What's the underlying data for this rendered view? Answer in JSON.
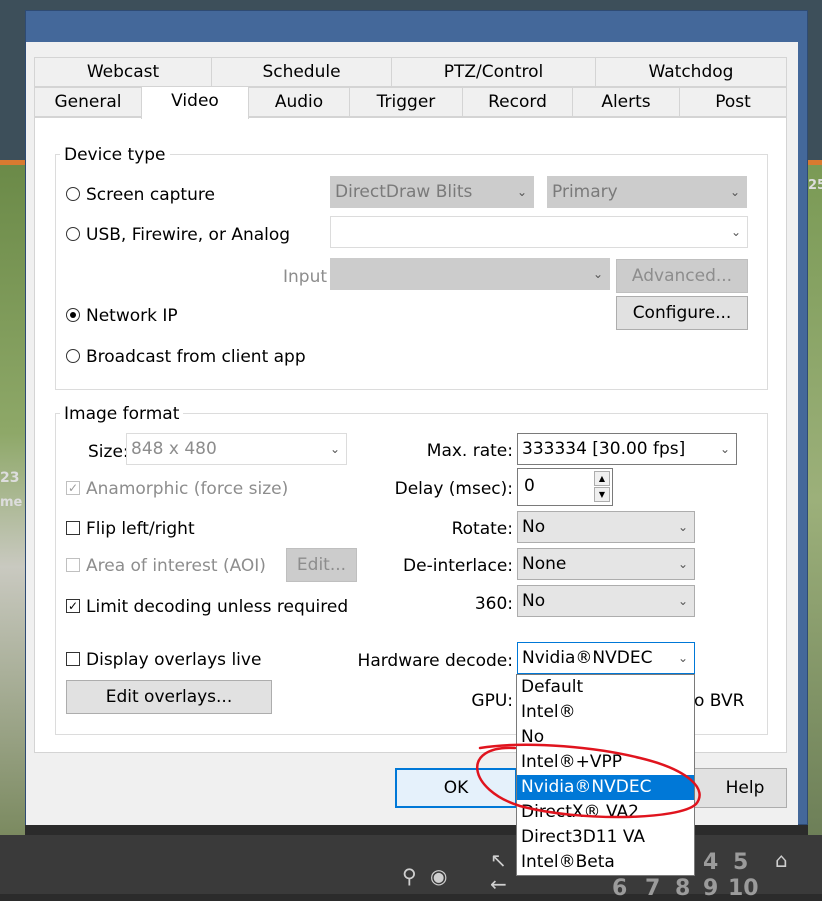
{
  "background": {
    "numbers": [
      "23",
      "25",
      "me",
      "4",
      "5",
      "6",
      "7",
      "8",
      "9",
      "10"
    ]
  },
  "tabs": {
    "row1": [
      "Webcast",
      "Schedule",
      "PTZ/Control",
      "Watchdog"
    ],
    "row2": [
      "General",
      "Video",
      "Audio",
      "Trigger",
      "Record",
      "Alerts",
      "Post"
    ],
    "active": "Video"
  },
  "device_type": {
    "title": "Device type",
    "screen_capture": "Screen capture",
    "screen_combo1": "DirectDraw Blits",
    "screen_combo2": "Primary",
    "usb": "USB, Firewire, or Analog",
    "usb_combo": "",
    "input_label": "Input",
    "input_combo": "",
    "advanced": "Advanced...",
    "network_ip": "Network IP",
    "configure": "Configure...",
    "broadcast": "Broadcast from client app"
  },
  "image_format": {
    "title": "Image format",
    "size_label": "Size:",
    "size_value": "848 x 480",
    "anamorphic": "Anamorphic (force size)",
    "flip": "Flip left/right",
    "aoi": "Area of interest (AOI)",
    "edit": "Edit...",
    "limit_decoding": "Limit decoding unless required",
    "display_overlays": "Display overlays live",
    "edit_overlays": "Edit overlays...",
    "max_rate_label": "Max. rate:",
    "max_rate_value": "333334 [30.00 fps]",
    "delay_label": "Delay (msec):",
    "delay_value": "0",
    "rotate_label": "Rotate:",
    "rotate_value": "No",
    "deinterlace_label": "De-interlace:",
    "deinterlace_value": "None",
    "r360_label": "360:",
    "r360_value": "No",
    "hw_label": "Hardware decode:",
    "hw_value": "Nvidia®NVDEC",
    "gpu_label": "GPU:",
    "gpu_trail": "o BVR"
  },
  "dropdown": {
    "options": [
      "Default",
      "Intel®",
      "No",
      "Intel®+VPP",
      "Nvidia®NVDEC",
      "DirectX® VA2",
      "Direct3D11 VA",
      "Intel®Beta"
    ],
    "selected_index": 4
  },
  "buttons": {
    "ok": "OK",
    "help": "Help"
  },
  "colors": {
    "selection": "#0078d7",
    "annotation": "#e0141e",
    "title_bar": "#44689a"
  }
}
